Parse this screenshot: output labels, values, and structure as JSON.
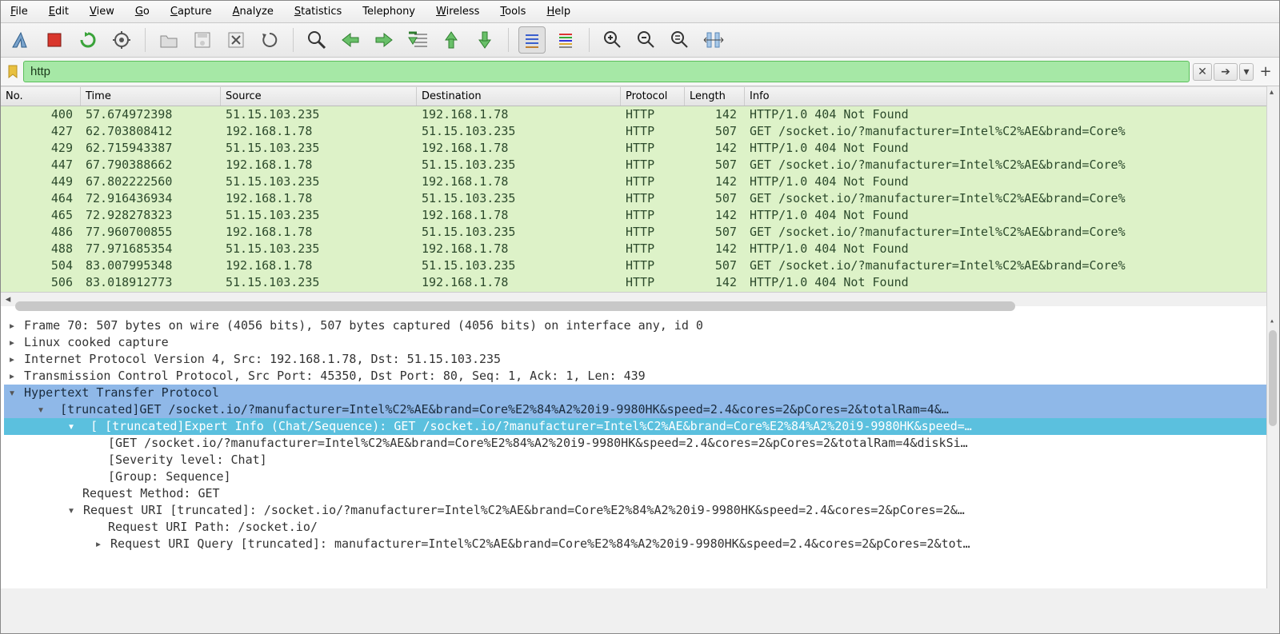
{
  "menu": {
    "file": "File",
    "edit": "Edit",
    "view": "View",
    "go": "Go",
    "capture": "Capture",
    "analyze": "Analyze",
    "statistics": "Statistics",
    "telephony": "Telephony",
    "wireless": "Wireless",
    "tools": "Tools",
    "help": "Help"
  },
  "filter": {
    "value": "http",
    "plus": "+"
  },
  "packet_columns": {
    "no": "No.",
    "time": "Time",
    "source": "Source",
    "destination": "Destination",
    "protocol": "Protocol",
    "length": "Length",
    "info": "Info"
  },
  "packets": [
    {
      "no": "400",
      "time": "57.674972398",
      "src": "51.15.103.235",
      "dst": "192.168.1.78",
      "proto": "HTTP",
      "len": "142",
      "info": "HTTP/1.0 404 Not Found"
    },
    {
      "no": "427",
      "time": "62.703808412",
      "src": "192.168.1.78",
      "dst": "51.15.103.235",
      "proto": "HTTP",
      "len": "507",
      "info": "GET /socket.io/?manufacturer=Intel%C2%AE&brand=Core%"
    },
    {
      "no": "429",
      "time": "62.715943387",
      "src": "51.15.103.235",
      "dst": "192.168.1.78",
      "proto": "HTTP",
      "len": "142",
      "info": "HTTP/1.0 404 Not Found"
    },
    {
      "no": "447",
      "time": "67.790388662",
      "src": "192.168.1.78",
      "dst": "51.15.103.235",
      "proto": "HTTP",
      "len": "507",
      "info": "GET /socket.io/?manufacturer=Intel%C2%AE&brand=Core%"
    },
    {
      "no": "449",
      "time": "67.802222560",
      "src": "51.15.103.235",
      "dst": "192.168.1.78",
      "proto": "HTTP",
      "len": "142",
      "info": "HTTP/1.0 404 Not Found"
    },
    {
      "no": "464",
      "time": "72.916436934",
      "src": "192.168.1.78",
      "dst": "51.15.103.235",
      "proto": "HTTP",
      "len": "507",
      "info": "GET /socket.io/?manufacturer=Intel%C2%AE&brand=Core%"
    },
    {
      "no": "465",
      "time": "72.928278323",
      "src": "51.15.103.235",
      "dst": "192.168.1.78",
      "proto": "HTTP",
      "len": "142",
      "info": "HTTP/1.0 404 Not Found"
    },
    {
      "no": "486",
      "time": "77.960700855",
      "src": "192.168.1.78",
      "dst": "51.15.103.235",
      "proto": "HTTP",
      "len": "507",
      "info": "GET /socket.io/?manufacturer=Intel%C2%AE&brand=Core%"
    },
    {
      "no": "488",
      "time": "77.971685354",
      "src": "51.15.103.235",
      "dst": "192.168.1.78",
      "proto": "HTTP",
      "len": "142",
      "info": "HTTP/1.0 404 Not Found"
    },
    {
      "no": "504",
      "time": "83.007995348",
      "src": "192.168.1.78",
      "dst": "51.15.103.235",
      "proto": "HTTP",
      "len": "507",
      "info": "GET /socket.io/?manufacturer=Intel%C2%AE&brand=Core%"
    },
    {
      "no": "506",
      "time": "83.018912773",
      "src": "51.15.103.235",
      "dst": "192.168.1.78",
      "proto": "HTTP",
      "len": "142",
      "info": "HTTP/1.0 404 Not Found"
    }
  ],
  "details": {
    "frame": "Frame 70: 507 bytes on wire (4056 bits), 507 bytes captured (4056 bits) on interface any, id 0",
    "linux_cooked": "Linux cooked capture",
    "ip": "Internet Protocol Version 4, Src: 192.168.1.78, Dst: 51.15.103.235",
    "tcp": "Transmission Control Protocol, Src Port: 45350, Dst Port: 80, Seq: 1, Ack: 1, Len: 439",
    "http": "Hypertext Transfer Protocol",
    "http_get": "[truncated]GET /socket.io/?manufacturer=Intel%C2%AE&brand=Core%E2%84%A2%20i9-9980HK&speed=2.4&cores=2&pCores=2&totalRam=4&…",
    "expert": "[ [truncated]Expert Info (Chat/Sequence): GET /socket.io/?manufacturer=Intel%C2%AE&brand=Core%E2%84%A2%20i9-9980HK&speed=…",
    "get_full": "[GET /socket.io/?manufacturer=Intel%C2%AE&brand=Core%E2%84%A2%20i9-9980HK&speed=2.4&cores=2&pCores=2&totalRam=4&diskSi…",
    "severity": "[Severity level: Chat]",
    "group": "[Group: Sequence]",
    "method": "Request Method: GET",
    "uri": "Request URI [truncated]: /socket.io/?manufacturer=Intel%C2%AE&brand=Core%E2%84%A2%20i9-9980HK&speed=2.4&cores=2&pCores=2&…",
    "uri_path": "Request URI Path: /socket.io/",
    "uri_query": "Request URI Query [truncated]: manufacturer=Intel%C2%AE&brand=Core%E2%84%A2%20i9-9980HK&speed=2.4&cores=2&pCores=2&tot…"
  }
}
